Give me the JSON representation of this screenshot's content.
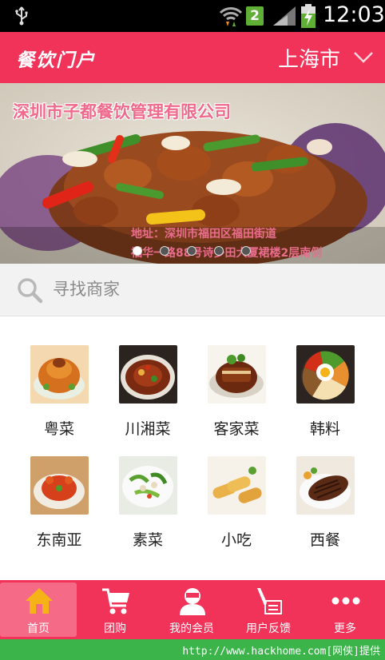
{
  "status_bar": {
    "sim_slot": "2",
    "time": "12:03"
  },
  "header": {
    "app_title": "餐饮门户",
    "city": "上海市"
  },
  "banner": {
    "company_name": "深圳市子都餐饮管理有限公司",
    "address_line1": "地址：深圳市福田区福田街道",
    "address_line2": "福华一路88号诗多田大厦裙楼2层南侧",
    "slide_count": 5,
    "active_slide": 1
  },
  "search": {
    "placeholder": "寻找商家"
  },
  "categories": [
    {
      "label": "粤菜",
      "icon": "cantonese-dish"
    },
    {
      "label": "川湘菜",
      "icon": "sichuan-dish"
    },
    {
      "label": "客家菜",
      "icon": "hakka-dish"
    },
    {
      "label": "韩料",
      "icon": "korean-dish"
    },
    {
      "label": "东南亚",
      "icon": "southeast-asian-dish"
    },
    {
      "label": "素菜",
      "icon": "vegetarian-dish"
    },
    {
      "label": "小吃",
      "icon": "snack-dish"
    },
    {
      "label": "西餐",
      "icon": "western-dish"
    }
  ],
  "bottom_nav": [
    {
      "label": "首页",
      "icon": "home-icon",
      "active": true
    },
    {
      "label": "团购",
      "icon": "cart-icon",
      "active": false
    },
    {
      "label": "我的会员",
      "icon": "member-icon",
      "active": false
    },
    {
      "label": "用户反馈",
      "icon": "feedback-icon",
      "active": false
    },
    {
      "label": "更多",
      "icon": "more-icon",
      "active": false
    }
  ],
  "watermark": "http://www.hackhome.com[网侠]提供",
  "colors": {
    "brand": "#f1335a",
    "nav_active": "#f56b87",
    "watermark": "#3bb44a"
  }
}
